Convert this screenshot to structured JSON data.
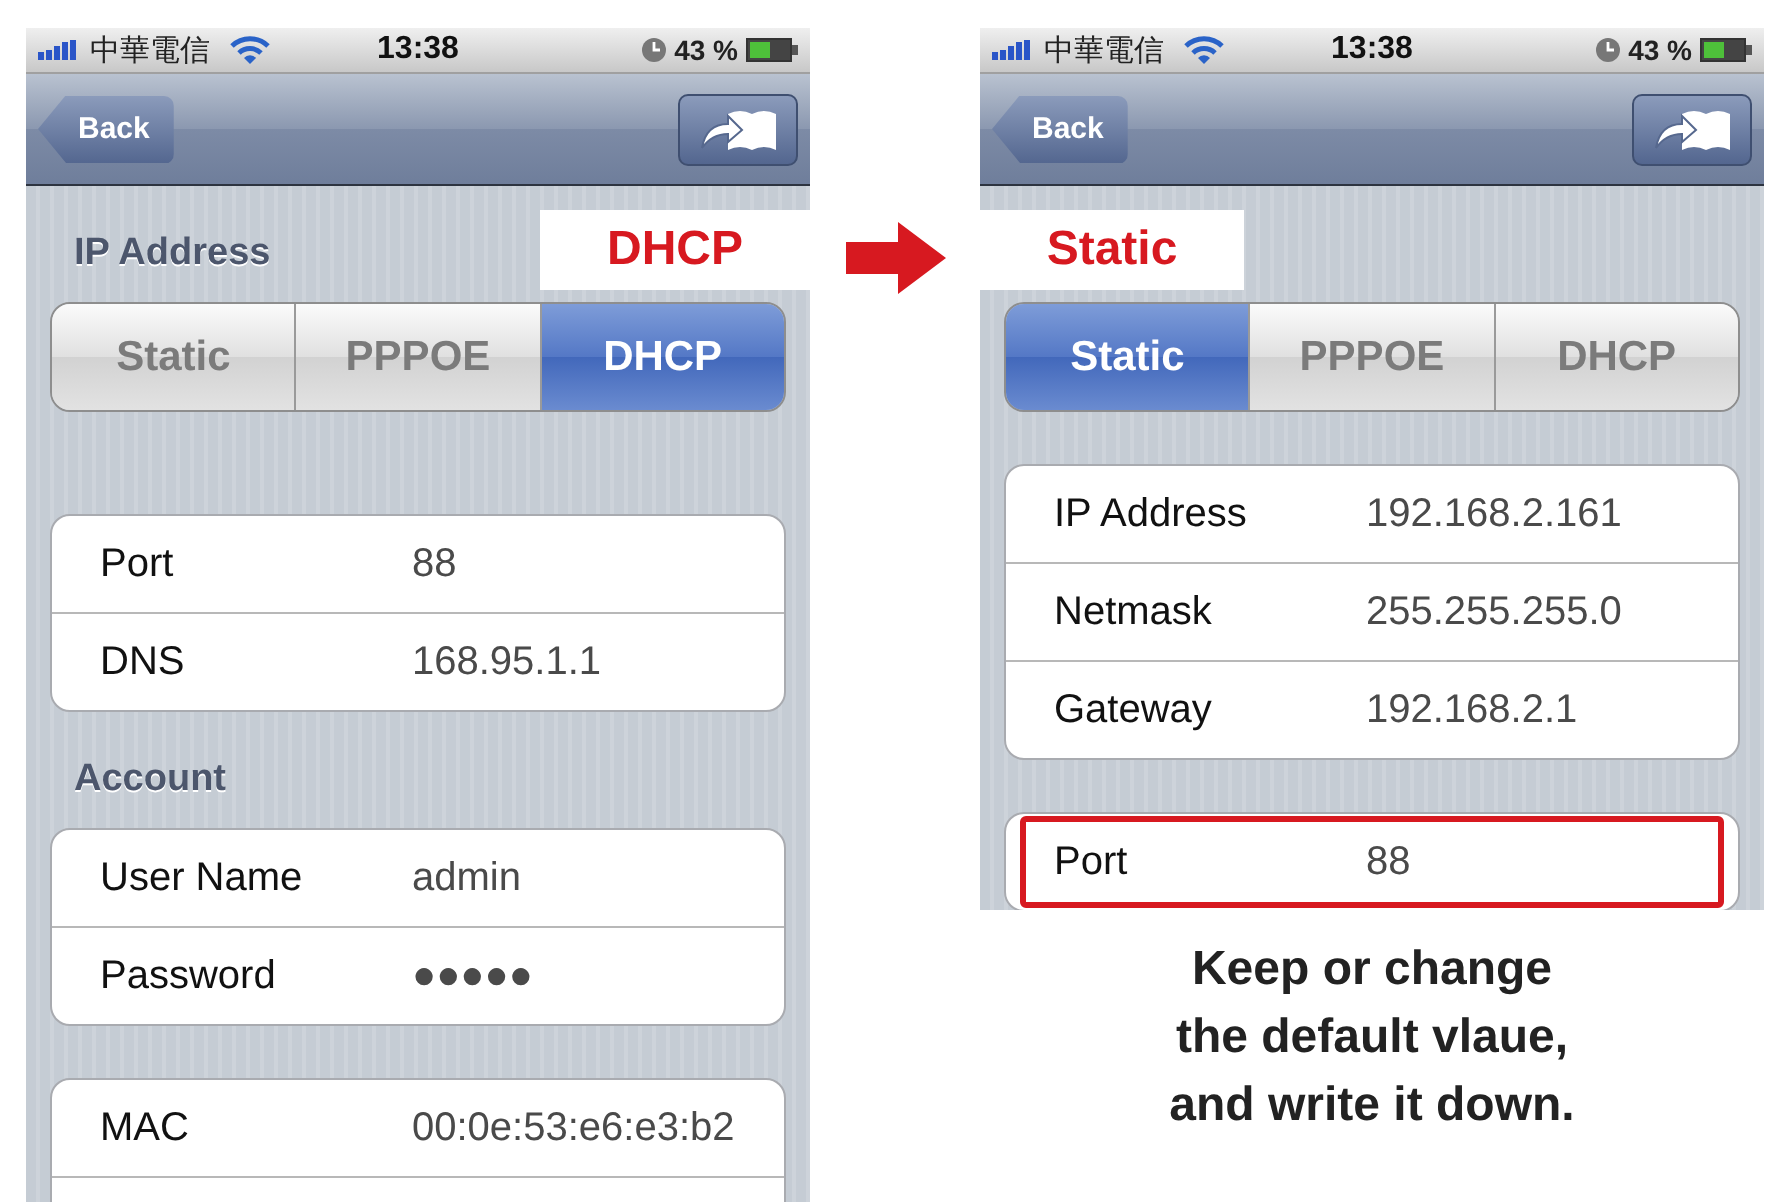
{
  "phones": [
    {
      "status_bar": {
        "carrier": "中華電信",
        "time": "13:38",
        "battery": "43 %"
      },
      "nav": {
        "back": "Back"
      },
      "callout": "DHCP",
      "sections": [
        {
          "kind": "segmented",
          "header": "IP Address",
          "segments": [
            {
              "label": "Static",
              "selected": false
            },
            {
              "label": "PPPOE",
              "selected": false
            },
            {
              "label": "DHCP",
              "selected": true
            }
          ]
        },
        {
          "kind": "group",
          "rows": [
            {
              "label": "Port",
              "value": "88",
              "highlighted": false
            },
            {
              "label": "DNS",
              "value": "168.95.1.1",
              "highlighted": false
            }
          ]
        },
        {
          "kind": "group",
          "header": "Account",
          "rows": [
            {
              "label": "User Name",
              "value": "admin",
              "highlighted": false
            },
            {
              "label": "Password",
              "value": "●●●●●",
              "highlighted": false
            }
          ]
        },
        {
          "kind": "group",
          "continues": true,
          "rows": [
            {
              "label": "MAC",
              "value": "00:0e:53:e6:e3:b2",
              "highlighted": false
            }
          ]
        }
      ]
    },
    {
      "status_bar": {
        "carrier": "中華電信",
        "time": "13:38",
        "battery": "43 %"
      },
      "nav": {
        "back": "Back"
      },
      "callout": "Static",
      "sections": [
        {
          "kind": "segmented",
          "segments": [
            {
              "label": "Static",
              "selected": true
            },
            {
              "label": "PPPOE",
              "selected": false
            },
            {
              "label": "DHCP",
              "selected": false
            }
          ]
        },
        {
          "kind": "group",
          "rows": [
            {
              "label": "IP Address",
              "value": "192.168.2.161",
              "highlighted": false
            },
            {
              "label": "Netmask",
              "value": "255.255.255.0",
              "highlighted": false
            },
            {
              "label": "Gateway",
              "value": "192.168.2.1",
              "highlighted": false
            }
          ]
        },
        {
          "kind": "group",
          "rows": [
            {
              "label": "Port",
              "value": "88",
              "highlighted": true
            }
          ]
        }
      ]
    }
  ],
  "caption": "Keep or change\nthe default vlaue,\nand write it down."
}
